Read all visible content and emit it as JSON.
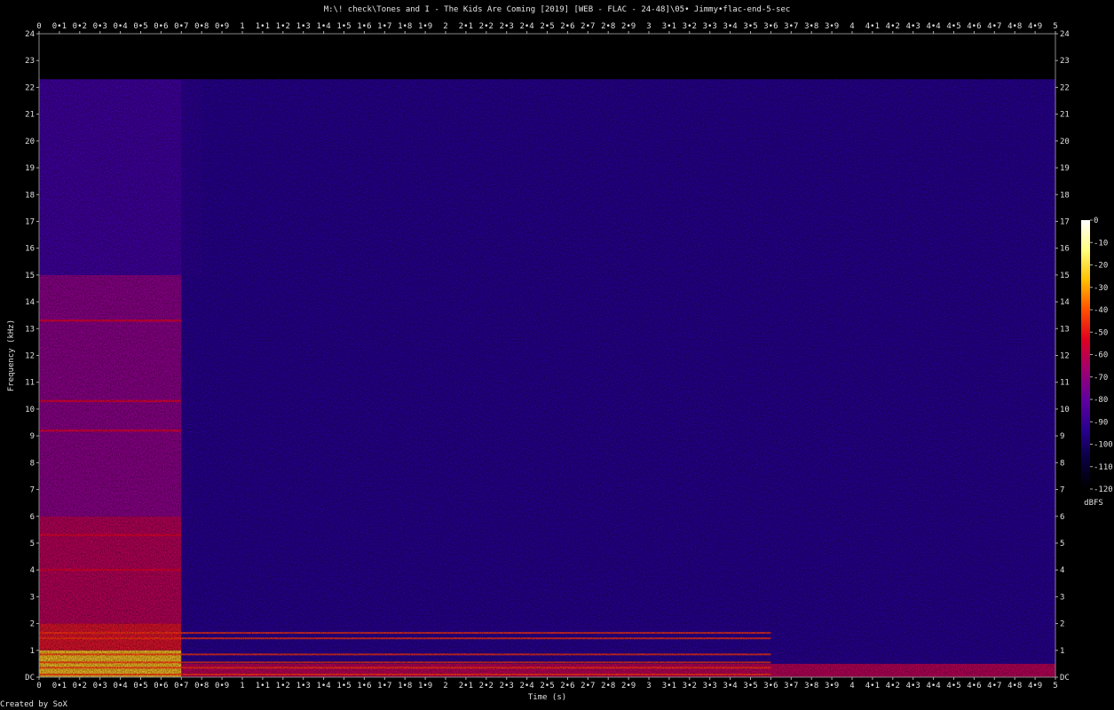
{
  "chart_data": {
    "type": "heatmap",
    "title": "M:\\! check\\Tones and I - The Kids Are Coming [2019] [WEB - FLAC - 24-48]\\05• Jimmy•flac-end-5-sec",
    "xlabel": "Time (s)",
    "ylabel": "Frequency (kHz)",
    "xlim": [
      0,
      5
    ],
    "ylim": [
      0,
      24
    ],
    "x_ticks": [
      "0",
      "0•1",
      "0•2",
      "0•3",
      "0•4",
      "0•5",
      "0•6",
      "0•7",
      "0•8",
      "0•9",
      "1",
      "1•1",
      "1•2",
      "1•3",
      "1•4",
      "1•5",
      "1•6",
      "1•7",
      "1•8",
      "1•9",
      "2",
      "2•1",
      "2•2",
      "2•3",
      "2•4",
      "2•5",
      "2•6",
      "2•7",
      "2•8",
      "2•9",
      "3",
      "3•1",
      "3•2",
      "3•3",
      "3•4",
      "3•5",
      "3•6",
      "3•7",
      "3•8",
      "3•9",
      "4",
      "4•1",
      "4•2",
      "4•3",
      "4•4",
      "4•5",
      "4•6",
      "4•7",
      "4•8",
      "4•9",
      "5"
    ],
    "y_ticks": [
      "DC",
      "1",
      "2",
      "3",
      "4",
      "5",
      "6",
      "7",
      "8",
      "9",
      "10",
      "11",
      "12",
      "13",
      "14",
      "15",
      "16",
      "17",
      "18",
      "19",
      "20",
      "21",
      "22",
      "23",
      "24"
    ],
    "colorbar": {
      "label": "dBFS",
      "ticks": [
        "0",
        "-10",
        "-20",
        "-30",
        "-40",
        "-50",
        "-60",
        "-70",
        "-80",
        "-90",
        "-100",
        "-110",
        "-120"
      ],
      "range": [
        -120,
        0
      ],
      "stops": [
        "#ffffff",
        "#ffff80",
        "#ffc000",
        "#ff5000",
        "#e00020",
        "#a00070",
        "#6000a0",
        "#2a0090",
        "#0a0040",
        "#000000"
      ]
    },
    "content_cutoff_khz": 22.3,
    "noise_floor_dbfs": -95,
    "regions": [
      {
        "t": [
          0.0,
          0.7
        ],
        "f": [
          0,
          1
        ],
        "dbfs": -25
      },
      {
        "t": [
          0.0,
          0.7
        ],
        "f": [
          1,
          2
        ],
        "dbfs": -50
      },
      {
        "t": [
          0.0,
          0.7
        ],
        "f": [
          2,
          6
        ],
        "dbfs": -60
      },
      {
        "t": [
          0.0,
          0.7
        ],
        "f": [
          6,
          15
        ],
        "dbfs": -70
      },
      {
        "t": [
          0.0,
          0.8
        ],
        "f": [
          15,
          22.3
        ],
        "dbfs": -88
      },
      {
        "t": [
          0.7,
          5.0
        ],
        "f": [
          0,
          0.5
        ],
        "dbfs": -60
      },
      {
        "t": [
          0.7,
          5.0
        ],
        "f": [
          0.5,
          22.3
        ],
        "dbfs": -95
      }
    ],
    "harmonic_lines_khz": [
      0.1,
      0.35,
      0.55,
      0.85,
      1.45,
      1.65,
      4.0,
      5.3,
      9.2,
      10.3,
      13.3
    ]
  },
  "footer": "Created by SoX"
}
